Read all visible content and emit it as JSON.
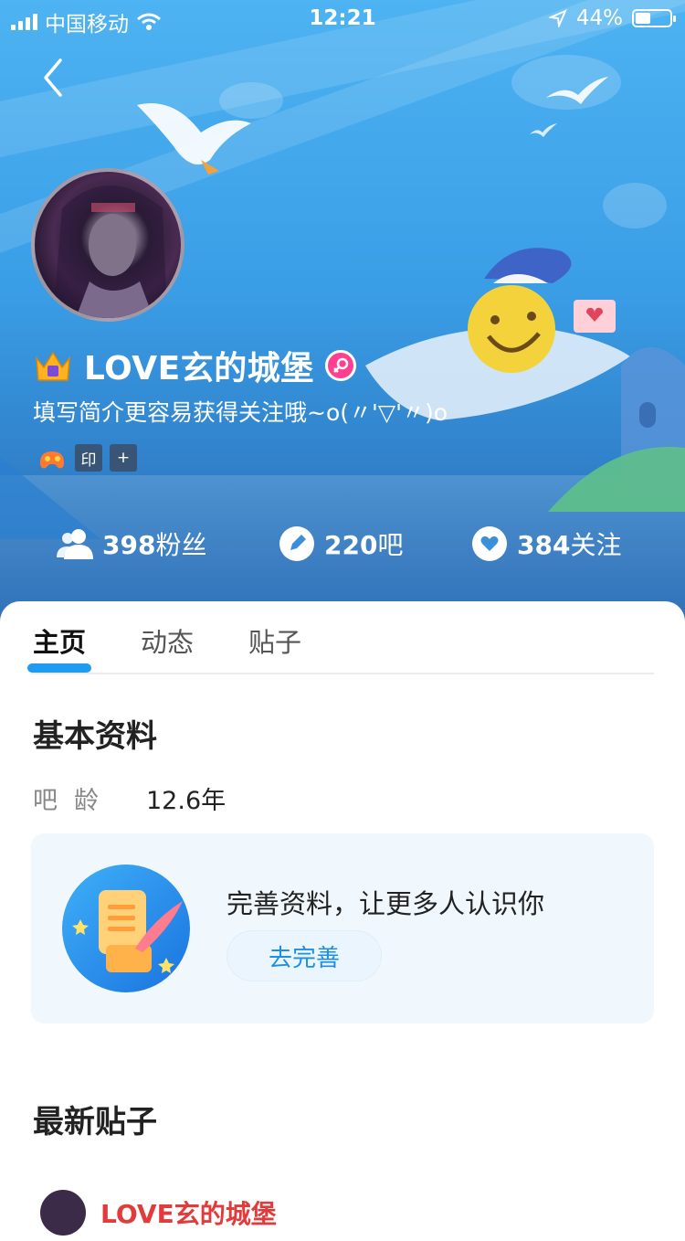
{
  "status_bar": {
    "carrier": "中国移动",
    "time": "12:21",
    "battery_text": "44%",
    "battery_level": 0.44
  },
  "profile": {
    "username": "LOVE玄的城堡",
    "intro": "填写简介更容易获得关注哦~o(〃'▽'〃)o",
    "badge_print": "印",
    "badge_add": "+"
  },
  "stats": {
    "fans_count": "398",
    "fans_label": "粉丝",
    "bars_count": "220",
    "bars_label": "吧",
    "follow_count": "384",
    "follow_label": "关注"
  },
  "tabs": [
    {
      "label": "主页"
    },
    {
      "label": "动态"
    },
    {
      "label": "贴子"
    }
  ],
  "basic_info": {
    "title": "基本资料",
    "age_label": "吧龄",
    "age_value": "12.6年"
  },
  "promo": {
    "text": "完善资料，让更多人认识你",
    "button": "去完善"
  },
  "latest_posts": {
    "title": "最新贴子",
    "first_author": "LOVE玄的城堡"
  },
  "colors": {
    "accent": "#1f9bf0",
    "hero_top": "#4db3f2",
    "gender_pink": "#ff3f8f",
    "post_name_red": "#e23b3b"
  }
}
